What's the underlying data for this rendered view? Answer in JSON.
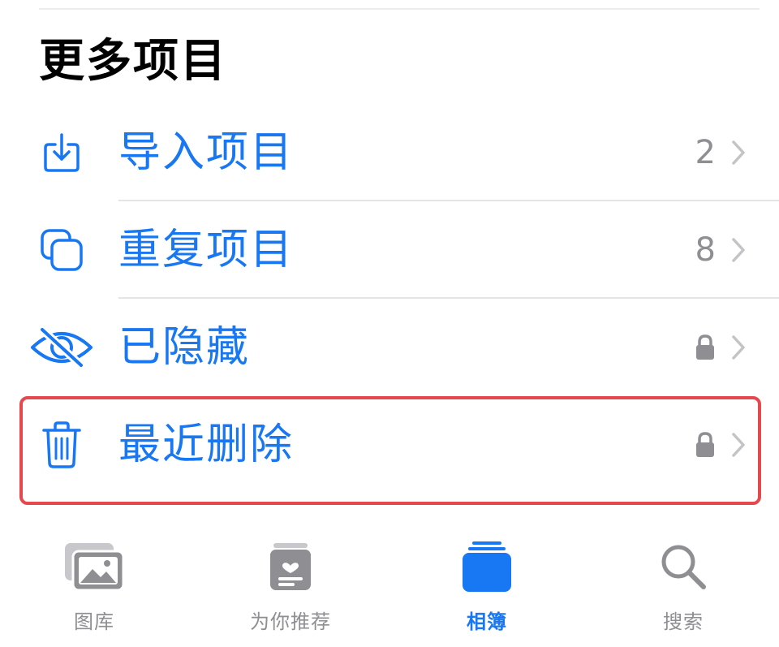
{
  "section": {
    "title": "更多项目"
  },
  "items": [
    {
      "label": "导入项目",
      "count": "2",
      "icon": "import-icon"
    },
    {
      "label": "重复项目",
      "count": "8",
      "icon": "duplicate-icon"
    },
    {
      "label": "已隐藏",
      "icon": "hidden-eye-icon",
      "locked": true
    },
    {
      "label": "最近删除",
      "icon": "trash-icon",
      "locked": true
    }
  ],
  "tabbar": {
    "tabs": [
      {
        "label": "图库",
        "icon": "library-icon"
      },
      {
        "label": "为你推荐",
        "icon": "for-you-icon"
      },
      {
        "label": "相簿",
        "icon": "albums-icon",
        "active": true
      },
      {
        "label": "搜索",
        "icon": "search-icon"
      }
    ]
  },
  "colors": {
    "accent": "#1877f2",
    "secondary": "#8e8e93",
    "highlight": "#e5484d"
  }
}
